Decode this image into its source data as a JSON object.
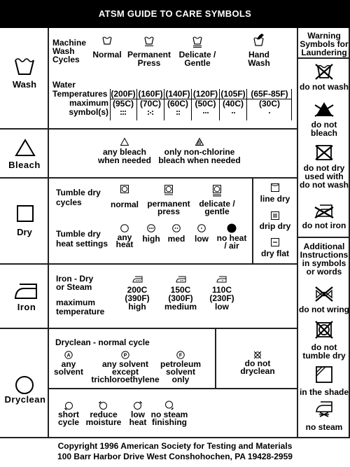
{
  "title": "ATSM GUIDE TO CARE SYMBOLS",
  "wash": {
    "label": "Wash",
    "machine_label": "Machine Wash Cycles",
    "machine_label_lines": [
      "Machine",
      "Wash",
      "Cycles"
    ],
    "cycles": [
      {
        "icon": "wash-tub-normal-icon",
        "lines": [
          "Normal"
        ]
      },
      {
        "icon": "wash-tub-permanent-press-icon",
        "lines": [
          "Permanent",
          "Press"
        ]
      },
      {
        "icon": "wash-tub-delicate-icon",
        "lines": [
          "Delicate /",
          "Gentle"
        ]
      },
      {
        "icon": "hand-wash-icon",
        "lines": [
          "Hand",
          "Wash"
        ]
      }
    ],
    "temp_label_lines": [
      "Water",
      "Temperatures",
      "maximum",
      "symbol(s)"
    ],
    "temperatures": [
      {
        "f": "(200F)",
        "c": "(95C)",
        "dots": 6
      },
      {
        "f": "(160F)",
        "c": "(70C)",
        "dots": 5
      },
      {
        "f": "(140F)",
        "c": "(60C)",
        "dots": 4
      },
      {
        "f": "(120F)",
        "c": "(50C)",
        "dots": 3
      },
      {
        "f": "(105F)",
        "c": "(40C)",
        "dots": 2
      },
      {
        "f": "(65F-85F)",
        "c": "(30C)",
        "dots": 1
      }
    ]
  },
  "bleach": {
    "label": "Bleach",
    "options": [
      {
        "icon": "triangle-icon",
        "lines": [
          "any bleach",
          "when needed"
        ]
      },
      {
        "icon": "striped-triangle-icon",
        "lines": [
          "only non-chlorine",
          "bleach when needed"
        ]
      }
    ]
  },
  "dry": {
    "label": "Dry",
    "tumble_cycles_label": [
      "Tumble dry",
      "cycles"
    ],
    "tumble_cycles": [
      {
        "icon": "tumble-normal-icon",
        "lines": [
          "normal"
        ]
      },
      {
        "icon": "tumble-permanent-press-icon",
        "lines": [
          "permanent",
          "press"
        ]
      },
      {
        "icon": "tumble-delicate-icon",
        "lines": [
          "delicate /",
          "gentle"
        ]
      }
    ],
    "heat_label": [
      "Tumble dry",
      "heat settings"
    ],
    "heat_settings": [
      {
        "icon": "circle-any-heat-icon",
        "lines": [
          "any",
          "heat"
        ]
      },
      {
        "icon": "circle-three-dots-icon",
        "lines": [
          "high"
        ]
      },
      {
        "icon": "circle-two-dots-icon",
        "lines": [
          "med"
        ]
      },
      {
        "icon": "circle-one-dot-icon",
        "lines": [
          "low"
        ]
      },
      {
        "icon": "filled-circle-icon",
        "lines": [
          "no heat",
          "/ air"
        ]
      }
    ],
    "natural": [
      {
        "icon": "line-dry-icon",
        "label": "line dry"
      },
      {
        "icon": "drip-dry-icon",
        "label": "drip dry"
      },
      {
        "icon": "dry-flat-icon",
        "label": "dry flat"
      }
    ]
  },
  "iron": {
    "label": "Iron",
    "desc_lines": [
      "Iron - Dry",
      "or Steam"
    ],
    "max_lines": [
      "maximum",
      "temperature"
    ],
    "settings": [
      {
        "icon": "iron-three-dots-icon",
        "lines": [
          "200C",
          "(390F)",
          "high"
        ]
      },
      {
        "icon": "iron-two-dots-icon",
        "lines": [
          "150C",
          "(300F)",
          "medium"
        ]
      },
      {
        "icon": "iron-one-dot-icon",
        "lines": [
          "110C",
          "(230F)",
          "low"
        ]
      }
    ]
  },
  "dryclean": {
    "label": "Dryclean",
    "normal_cycle_label": "Dryclean - normal cycle",
    "solvents": [
      {
        "icon": "circle-a-icon",
        "letter": "A",
        "lines": [
          "any",
          "solvent"
        ]
      },
      {
        "icon": "circle-p-icon",
        "letter": "P",
        "lines": [
          "any solvent",
          "except",
          "trichloroethylene"
        ]
      },
      {
        "icon": "circle-f-icon",
        "letter": "F",
        "lines": [
          "petroleum",
          "solvent",
          "only"
        ]
      }
    ],
    "do_not": {
      "icon": "do-not-dryclean-icon",
      "lines": [
        "do not",
        "dryclean"
      ]
    },
    "modifiers": [
      {
        "icon": "short-cycle-icon",
        "lines": [
          "short",
          "cycle"
        ]
      },
      {
        "icon": "reduce-moisture-icon",
        "lines": [
          "reduce",
          "moisture"
        ]
      },
      {
        "icon": "low-heat-icon",
        "lines": [
          "low",
          "heat"
        ]
      },
      {
        "icon": "no-steam-finishing-icon",
        "lines": [
          "no steam",
          "finishing"
        ]
      }
    ]
  },
  "warnings": {
    "header_lines": [
      "Warning",
      "Symbols for",
      "Laundering"
    ],
    "items": [
      {
        "icon": "do-not-wash-icon",
        "lines": [
          "do not wash"
        ]
      },
      {
        "icon": "do-not-bleach-icon",
        "lines": [
          "do not",
          "bleach"
        ]
      },
      {
        "icon": "do-not-dry-icon",
        "lines": [
          "do not dry",
          "used with",
          "do not wash"
        ]
      },
      {
        "icon": "do-not-iron-icon",
        "lines": [
          "do not iron"
        ]
      }
    ]
  },
  "additional": {
    "header_lines": [
      "Additional",
      "Instructions",
      "in symbols",
      "or words"
    ],
    "items": [
      {
        "icon": "do-not-wring-icon",
        "lines": [
          "do not wring"
        ]
      },
      {
        "icon": "do-not-tumble-dry-icon",
        "lines": [
          "do not",
          "tumble dry"
        ]
      },
      {
        "icon": "dry-in-shade-icon",
        "lines": [
          "in the shade"
        ]
      },
      {
        "icon": "no-steam-icon",
        "lines": [
          "no steam"
        ]
      }
    ]
  },
  "footer": {
    "line1": "Copyright 1996 American Society for Testing and Materials",
    "line2": "100 Barr Harbor Drive West Conshohochen, PA 19428-2959"
  }
}
